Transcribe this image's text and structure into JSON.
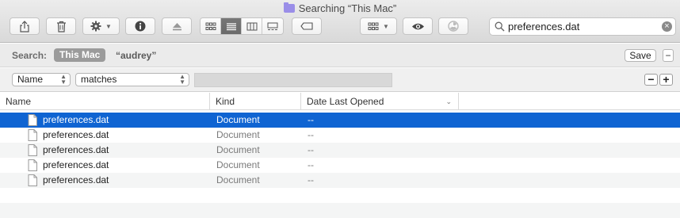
{
  "window": {
    "title": "Searching “This Mac”"
  },
  "toolbar": {
    "icons": [
      "share-icon",
      "trash-icon",
      "gear-icon",
      "info-icon",
      "eject-icon",
      "icon-view-icon",
      "list-view-icon",
      "column-view-icon",
      "gallery-view-icon",
      "tag-icon",
      "group-icon",
      "eye-icon",
      "burn-icon"
    ]
  },
  "search": {
    "value": "preferences.dat",
    "placeholder": "Search"
  },
  "scope": {
    "label": "Search:",
    "this_mac": "This Mac",
    "user": "“audrey”",
    "save": "Save"
  },
  "criteria": {
    "attribute": "Name",
    "operator": "matches",
    "minus": "−",
    "plus": "+"
  },
  "table": {
    "columns": [
      "Name",
      "Kind",
      "Date Last Opened"
    ],
    "rows": [
      {
        "name": "preferences.dat",
        "kind": "Document",
        "date": "--"
      },
      {
        "name": "preferences.dat",
        "kind": "Document",
        "date": "--"
      },
      {
        "name": "preferences.dat",
        "kind": "Document",
        "date": "--"
      },
      {
        "name": "preferences.dat",
        "kind": "Document",
        "date": "--"
      },
      {
        "name": "preferences.dat",
        "kind": "Document",
        "date": "--"
      }
    ]
  },
  "colors": {
    "selection": "#0f64d2",
    "folder": "#9a8ee8"
  }
}
